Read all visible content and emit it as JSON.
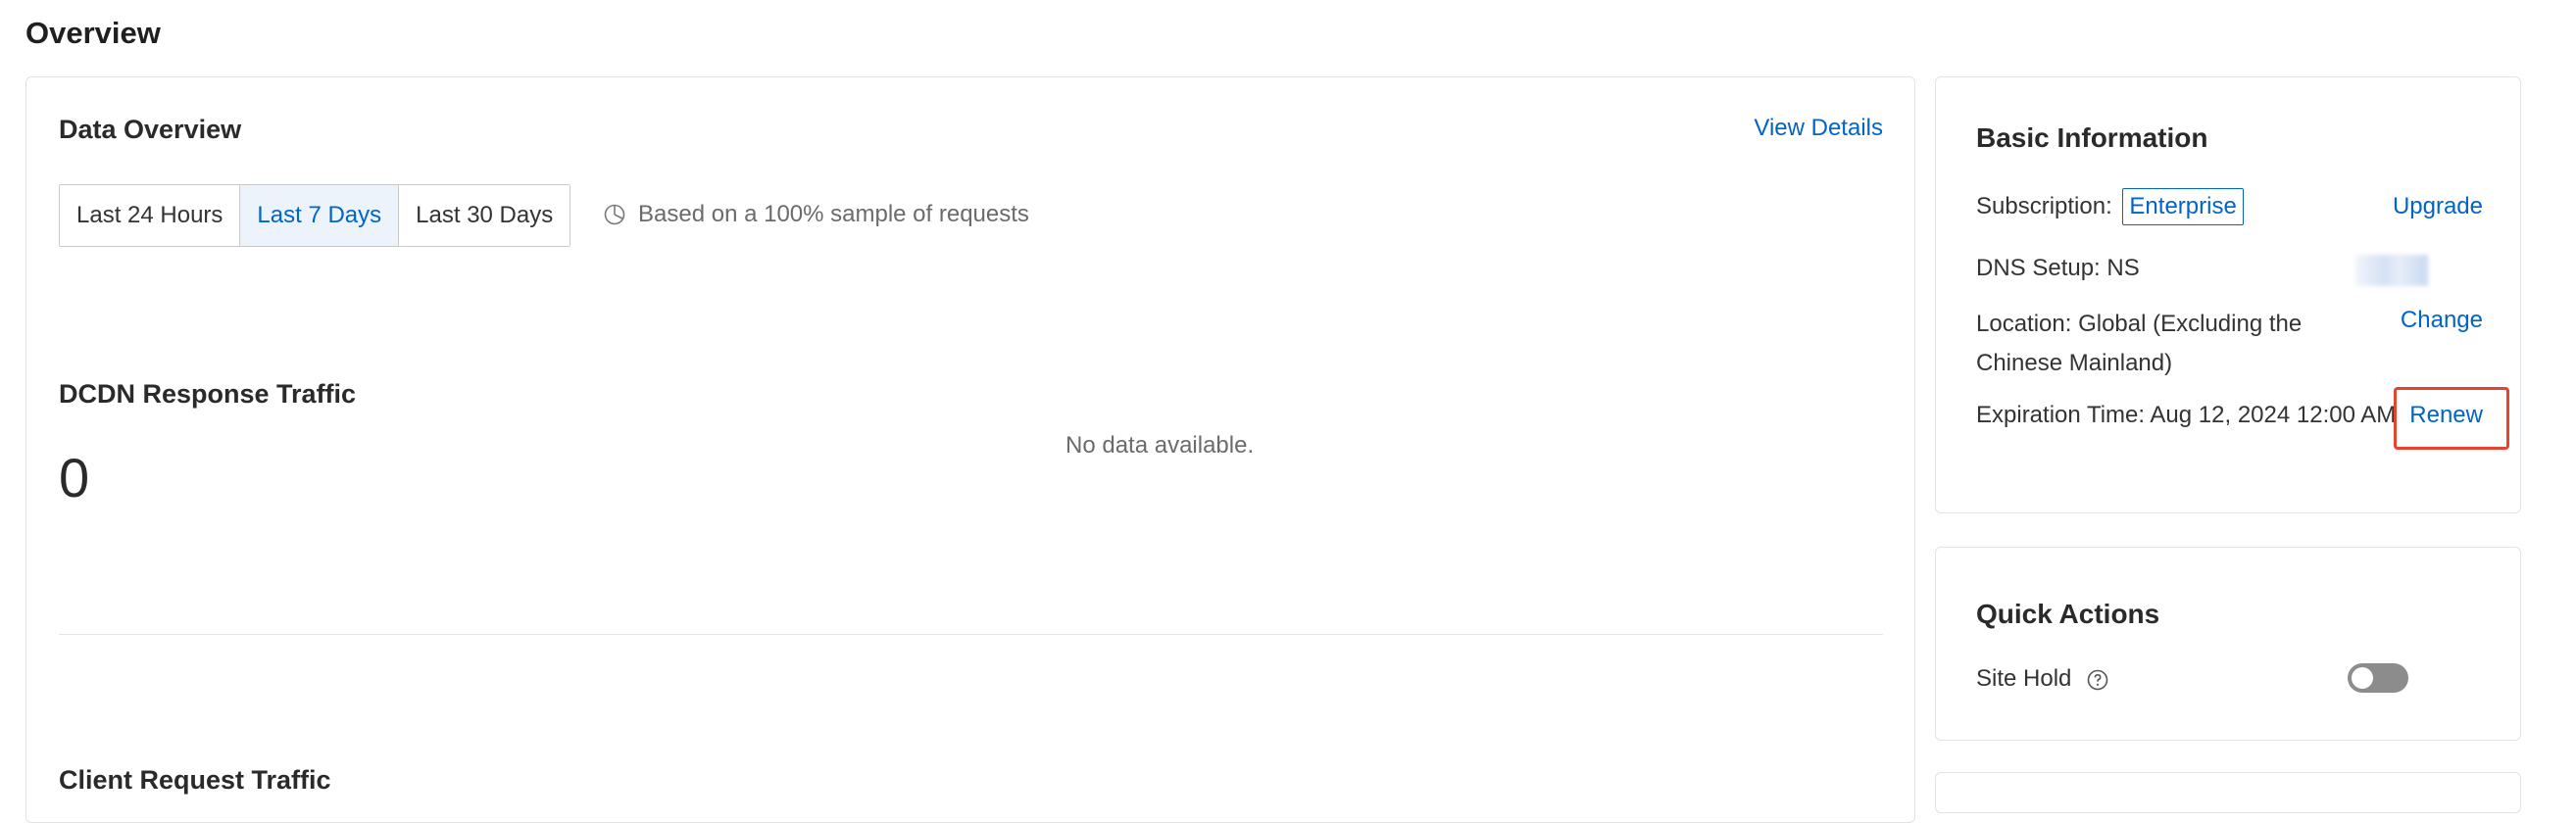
{
  "page": {
    "title": "Overview"
  },
  "data_overview": {
    "title": "Data Overview",
    "view_details": "View Details",
    "ranges": [
      {
        "label": "Last 24 Hours",
        "active": false
      },
      {
        "label": "Last 7 Days",
        "active": true
      },
      {
        "label": "Last 30 Days",
        "active": false
      }
    ],
    "sample_note": "Based on a 100% sample of requests",
    "response_traffic": {
      "title": "DCDN Response Traffic",
      "value": "0",
      "empty_text": "No data available."
    },
    "client_request_traffic": {
      "title": "Client Request Traffic"
    }
  },
  "basic_info": {
    "title": "Basic Information",
    "subscription_label": "Subscription:",
    "subscription_value": "Enterprise",
    "upgrade": "Upgrade",
    "dns_setup": "DNS Setup: NS",
    "location": "Location: Global (Excluding the Chinese Mainland)",
    "change": "Change",
    "expiration": "Expiration Time: Aug 12, 2024 12:00 AM",
    "renew": "Renew"
  },
  "quick_actions": {
    "title": "Quick Actions",
    "site_hold_label": "Site Hold",
    "site_hold_enabled": false
  },
  "colors": {
    "link": "#0064c8",
    "highlight": "#e8432f",
    "active_bg": "#edf3fb"
  },
  "icons": {
    "sample": "pie-clock-icon",
    "help": "help-circle-icon"
  }
}
